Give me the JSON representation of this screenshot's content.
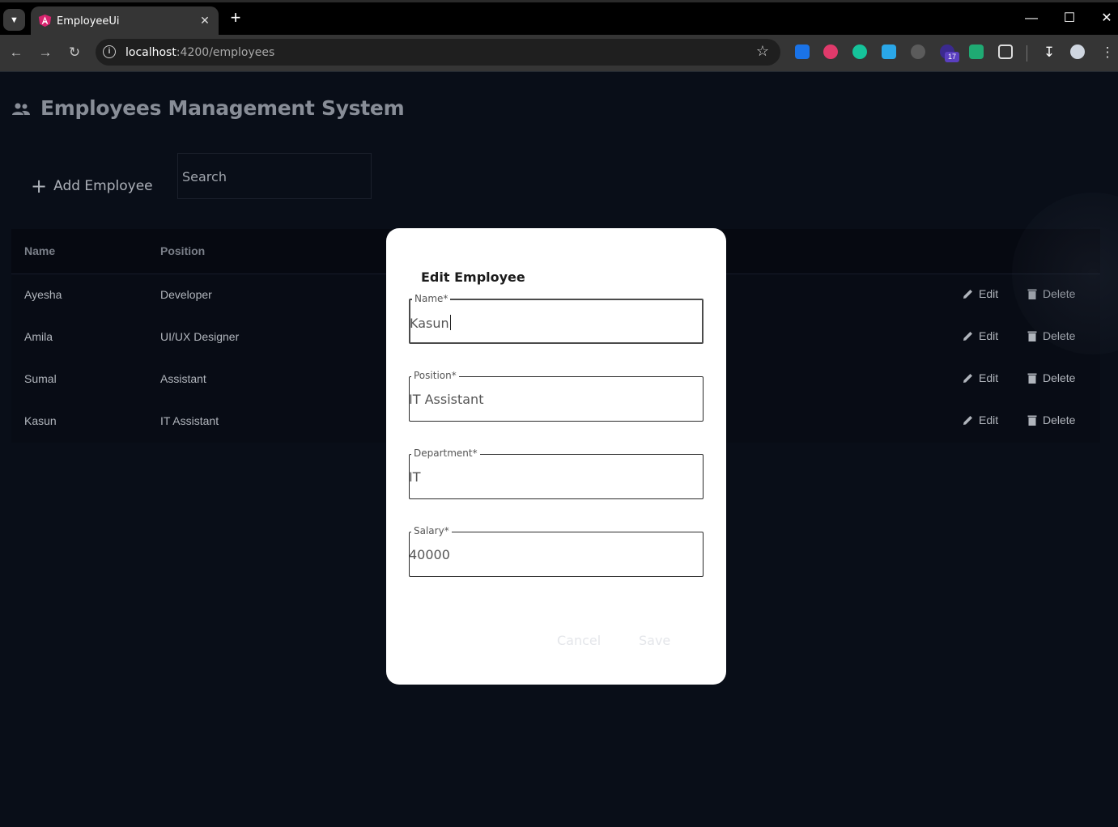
{
  "browser": {
    "tab_title": "EmployeeUi",
    "url_host": "localhost",
    "url_rest": ":4200/employees",
    "extension_badge": "17"
  },
  "app": {
    "title": "Employees Management System",
    "add_button_label": "Add Employee",
    "search_placeholder": "Search"
  },
  "table": {
    "columns": [
      "Name",
      "Position"
    ],
    "rows": [
      {
        "name": "Ayesha",
        "position": "Developer"
      },
      {
        "name": "Amila",
        "position": "UI/UX Designer"
      },
      {
        "name": "Sumal",
        "position": "Assistant"
      },
      {
        "name": "Kasun",
        "position": "IT Assistant"
      }
    ],
    "edit_label": "Edit",
    "delete_label": "Delete"
  },
  "dialog": {
    "title": "Edit Employee",
    "fields": {
      "name": {
        "label": "Name*",
        "value": "Kasun"
      },
      "position": {
        "label": "Position*",
        "value": "IT Assistant"
      },
      "department": {
        "label": "Department*",
        "value": "IT"
      },
      "salary": {
        "label": "Salary*",
        "value": "40000"
      }
    },
    "cancel_label": "Cancel",
    "save_label": "Save"
  }
}
